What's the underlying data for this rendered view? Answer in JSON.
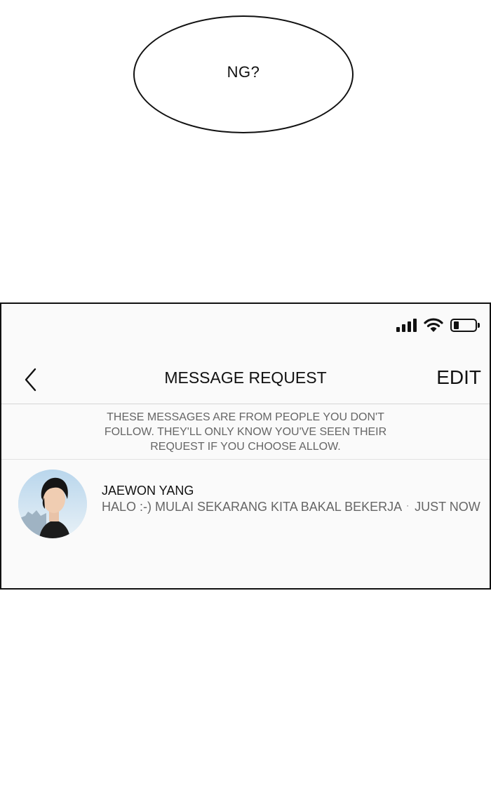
{
  "speech_bubble": {
    "text": "NG?"
  },
  "status_bar": {
    "signal_icon": "cellular-signal-icon",
    "wifi_icon": "wifi-icon",
    "battery_icon": "battery-icon",
    "battery_level_fraction": 0.15
  },
  "header": {
    "back_icon": "chevron-left-icon",
    "title": "MESSAGE REQUEST",
    "edit_label": "EDIT"
  },
  "notice": {
    "text": "THESE MESSAGES ARE FROM PEOPLE YOU DON'T FOLLOW. THEY'LL ONLY KNOW YOU'VE SEEN THEIR REQUEST IF YOU CHOOSE ALLOW."
  },
  "requests": [
    {
      "name": "JAEWON YANG",
      "preview": "HALO :-) MULAI SEKARANG KITA BAKAL BEKERJA",
      "separator": "·",
      "time": "JUST NOW"
    }
  ]
}
